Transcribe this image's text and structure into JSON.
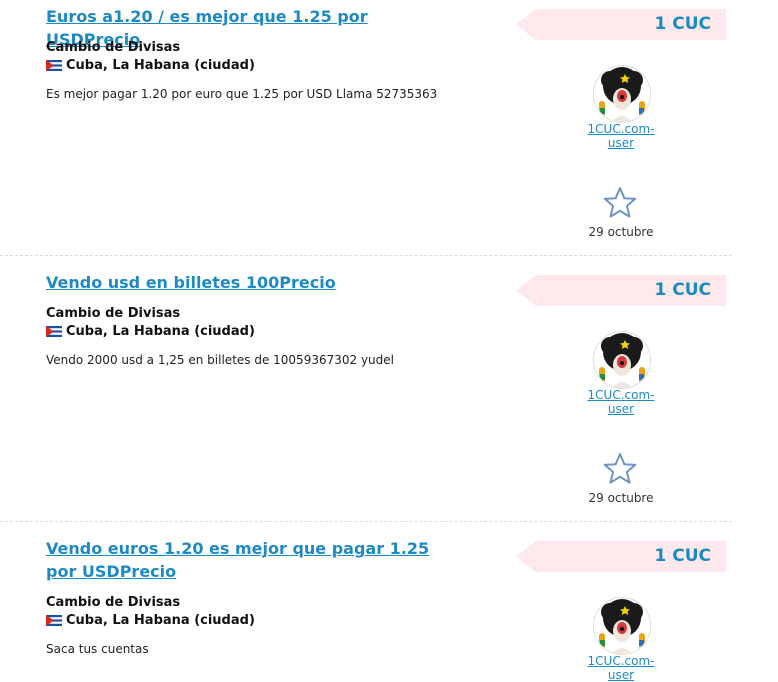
{
  "listings": [
    {
      "title": "Euros a1.20 / es mejor que 1.25 por USDPrecio",
      "category": "Cambio de Divisas",
      "location": "Cuba, La Habana (ciudad)",
      "description": "Es mejor pagar 1.20 por euro que 1.25 por USD Llama 52735363",
      "price": "1 CUC",
      "user": "1CUC.com-user",
      "date": "29 octubre"
    },
    {
      "title": "Vendo usd en billetes 100Precio",
      "category": "Cambio de Divisas",
      "location": "Cuba, La Habana (ciudad)",
      "description": "Vendo 2000 usd a 1,25 en billetes de 10059367302 yudel",
      "price": "1 CUC",
      "user": "1CUC.com-user",
      "date": "29 octubre"
    },
    {
      "title": "Vendo euros 1.20 es mejor que pagar 1.25 por USDPrecio",
      "category": "Cambio de Divisas",
      "location": "Cuba, La Habana (ciudad)",
      "description": "Saca tus cuentas",
      "price": "1 CUC",
      "user": "1CUC.com-user"
    }
  ],
  "colors": {
    "link": "#1f89c4",
    "price": "#1b8ac0",
    "price_bg": "#fde9ec"
  },
  "icons": {
    "flag": "cuba-flag-icon",
    "favorite": "star-outline-icon",
    "avatar": "afro-dog-avatar"
  }
}
